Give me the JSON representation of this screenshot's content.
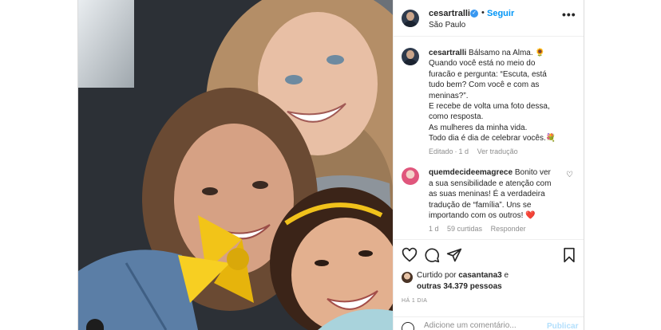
{
  "post": {
    "username": "cesartralli",
    "follow_label": "Seguir",
    "separator": "•",
    "location": "São Paulo",
    "more_label": "•••"
  },
  "caption": {
    "username": "cesartralli",
    "lines": [
      "Bálsamo na Alma. 🌻",
      "Quando você está no meio do",
      "furacão e pergunta: “Escuta, está",
      "tudo bem? Com você e com as",
      "meninas?”.",
      "E recebe de volta uma foto dessa,",
      "como resposta.",
      "As mulheres da minha vida.",
      "Todo dia é dia de celebrar vocês.💐"
    ],
    "edited": "Editado",
    "dot": "·",
    "age": "1 d",
    "translate": "Ver tradução"
  },
  "comment": {
    "username": "quemdecideemagrece",
    "lines": [
      "Bonito ver",
      "a sua sensibilidade e atenção com",
      "as suas meninas! É a verdadeira",
      "tradução de “família”. Uns se",
      "importando com os outros! ❤️"
    ],
    "age": "1 d",
    "likes": "59 curtidas",
    "reply": "Responder"
  },
  "likes": {
    "prefix": "Curtido por",
    "user": "casantana3",
    "and": "e",
    "others": "outras 34.379 pessoas"
  },
  "date": "HÁ 1 DIA",
  "add_comment": {
    "placeholder": "Adicione um comentário...",
    "publish": "Publicar"
  },
  "icons": {
    "verified": "verified-badge-icon",
    "like": "heart-icon",
    "comment": "comment-icon",
    "share": "paper-plane-icon",
    "save": "bookmark-icon",
    "emoji": "smiley-icon"
  },
  "colors": {
    "accent": "#0095f6",
    "verified": "#3897f0",
    "muted": "#8e8e8e",
    "publish_disabled": "#b2dffc"
  }
}
